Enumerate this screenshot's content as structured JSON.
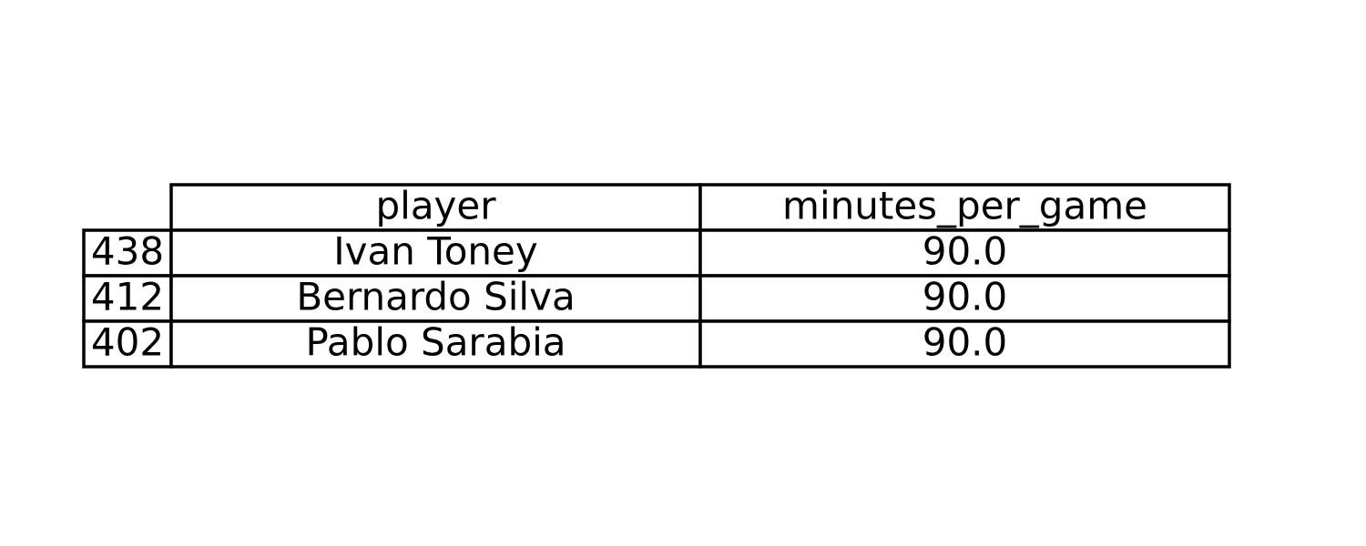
{
  "chart_data": {
    "type": "table",
    "columns": [
      "player",
      "minutes_per_game"
    ],
    "rows": [
      {
        "index": "438",
        "player": "Ivan Toney",
        "minutes_per_game": "90.0"
      },
      {
        "index": "412",
        "player": "Bernardo Silva",
        "minutes_per_game": "90.0"
      },
      {
        "index": "402",
        "player": "Pablo Sarabia",
        "minutes_per_game": "90.0"
      }
    ]
  },
  "colors": {
    "line": "#000000",
    "background": "#ffffff",
    "text": "#000000"
  }
}
